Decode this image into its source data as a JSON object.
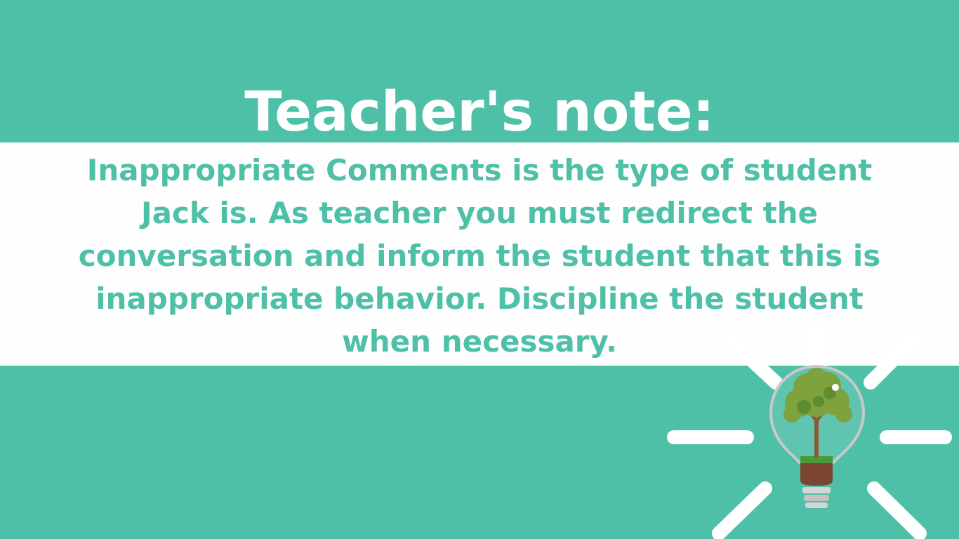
{
  "slide": {
    "title": "Teacher's note:",
    "body": "Inappropriate Comments is the type of student Jack is. As teacher you must redirect the conversation and inform the student that this is inappropriate behavior. Discipline the student when necessary."
  },
  "illustration": {
    "icon": "lightbulb-tree-icon"
  },
  "colors": {
    "background": "#4fc0a8",
    "band": "#fdfefd",
    "title_text": "#ffffff",
    "body_text": "#4fc0a8"
  }
}
